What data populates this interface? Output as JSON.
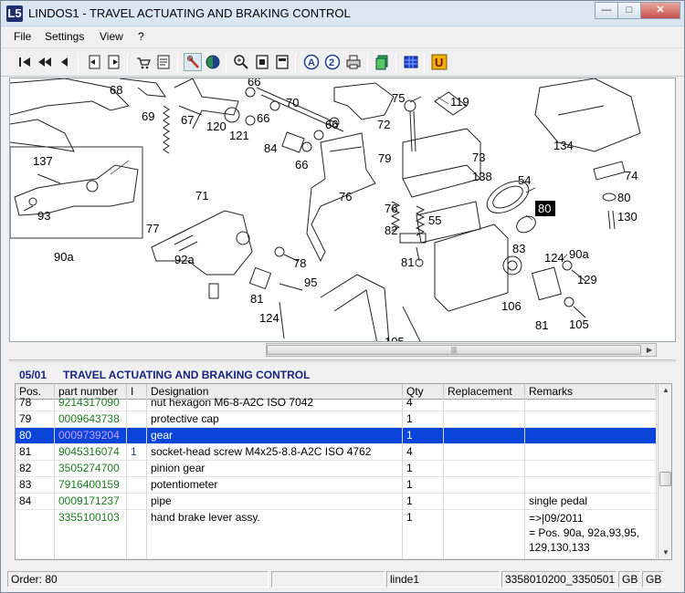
{
  "window": {
    "icon_text": "L5",
    "title": "LINDOS1 - TRAVEL ACTUATING AND BRAKING CONTROL",
    "buttons": [
      "minimize",
      "maximize",
      "close"
    ]
  },
  "menu": [
    "File",
    "Settings",
    "View",
    "?"
  ],
  "toolbar": {
    "icons": [
      "first-page-icon",
      "previous-group-icon",
      "previous-page-icon",
      "book-back-icon",
      "book-forward-icon",
      "cart-icon",
      "notepad-icon",
      "tool-icon",
      "globe-icon",
      "zoom-icon",
      "fit-page-icon",
      "fit-width-icon",
      "info-a-icon",
      "help-icon",
      "print-icon",
      "green-stack-icon",
      "blue-grid-icon",
      "u-icon"
    ]
  },
  "drawing": {
    "callouts": [
      "68",
      "66",
      "70",
      "75",
      "119",
      "69",
      "67",
      "120",
      "121",
      "66",
      "84",
      "66",
      "72",
      "73",
      "134",
      "137",
      "66",
      "79",
      "54",
      "74",
      "138",
      "93",
      "71",
      "76",
      "76",
      "55",
      "80",
      "56",
      "130",
      "77",
      "82",
      "83",
      "124",
      "90a",
      "90a",
      "92a",
      "78",
      "81",
      "129",
      "95",
      "81",
      "106",
      "124",
      "81",
      "105"
    ],
    "highlighted_callout": "80"
  },
  "section": {
    "code": "05/01",
    "title": "TRAVEL ACTUATING AND BRAKING CONTROL"
  },
  "table": {
    "columns": [
      "Pos.",
      "part number",
      "I",
      "Designation",
      "Qty",
      "Replacement",
      "Remarks"
    ],
    "rows": [
      {
        "pos": "78",
        "part": "9214317090",
        "i": "",
        "designation": "nut hexagon M6-8-A2C  ISO 7042",
        "qty": "4",
        "replacement": "",
        "remarks": ""
      },
      {
        "pos": "79",
        "part": "0009643738",
        "i": "",
        "designation": "protective cap",
        "qty": "1",
        "replacement": "",
        "remarks": ""
      },
      {
        "pos": "80",
        "part": "0009739204",
        "i": "",
        "designation": "gear",
        "qty": "1",
        "replacement": "",
        "remarks": ""
      },
      {
        "pos": "81",
        "part": "9045316074",
        "i": "1",
        "designation": "socket-head screw M4x25-8.8-A2C  ISO 4762",
        "qty": "4",
        "replacement": "",
        "remarks": ""
      },
      {
        "pos": "82",
        "part": "3505274700",
        "i": "",
        "designation": "pinion gear",
        "qty": "1",
        "replacement": "",
        "remarks": ""
      },
      {
        "pos": "83",
        "part": "7916400159",
        "i": "",
        "designation": "potentiometer",
        "qty": "1",
        "replacement": "",
        "remarks": ""
      },
      {
        "pos": "84",
        "part": "0009171237",
        "i": "",
        "designation": "pipe",
        "qty": "1",
        "replacement": "",
        "remarks": "single pedal"
      },
      {
        "pos": "",
        "part": "3355100103",
        "i": "",
        "designation": "hand brake lever assy.",
        "qty": "1",
        "replacement": "",
        "remarks": "=>|09/2011\n= Pos. 90a, 92a,93,95,\n129,130,133"
      }
    ],
    "selected_pos": "80"
  },
  "status": {
    "order": "Order: 80",
    "empty": "",
    "user": "linde1",
    "code": "3358010200_3350501",
    "lang1": "GB",
    "lang2": "GB"
  },
  "colors": {
    "selection": "#0a44d8",
    "part_number": "#1e7a1e",
    "heading": "#1a237e"
  }
}
